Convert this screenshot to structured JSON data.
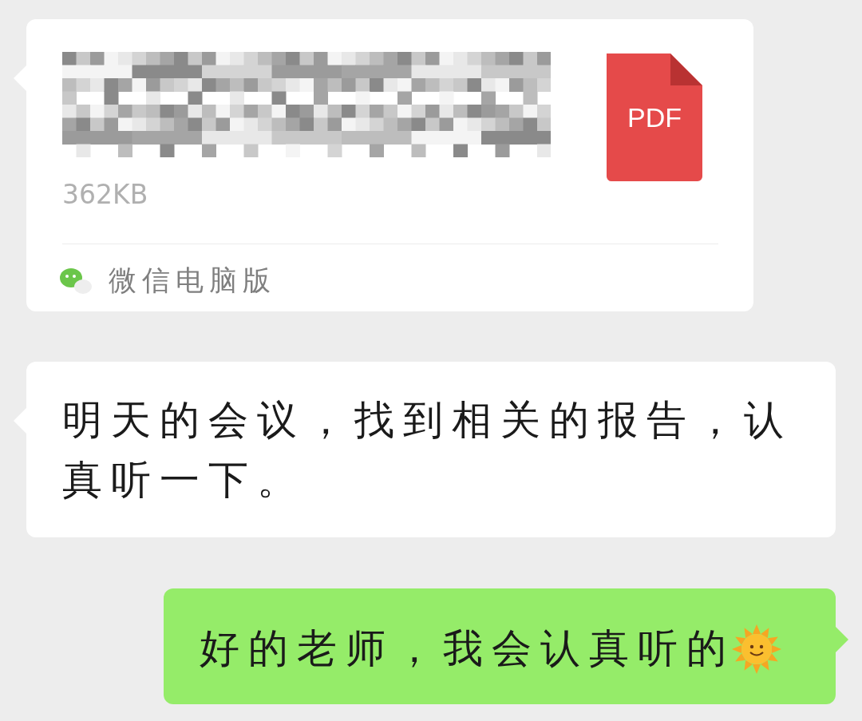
{
  "messages": [
    {
      "kind": "file",
      "outgoing": false,
      "size": "362KB",
      "file_type": "PDF",
      "source": "微信电脑版"
    },
    {
      "kind": "text",
      "outgoing": false,
      "text": "明天的会议，找到相关的报告，认真听一下。"
    },
    {
      "kind": "text",
      "outgoing": true,
      "text": "好的老师，我会认真听的",
      "emoji": true
    }
  ]
}
